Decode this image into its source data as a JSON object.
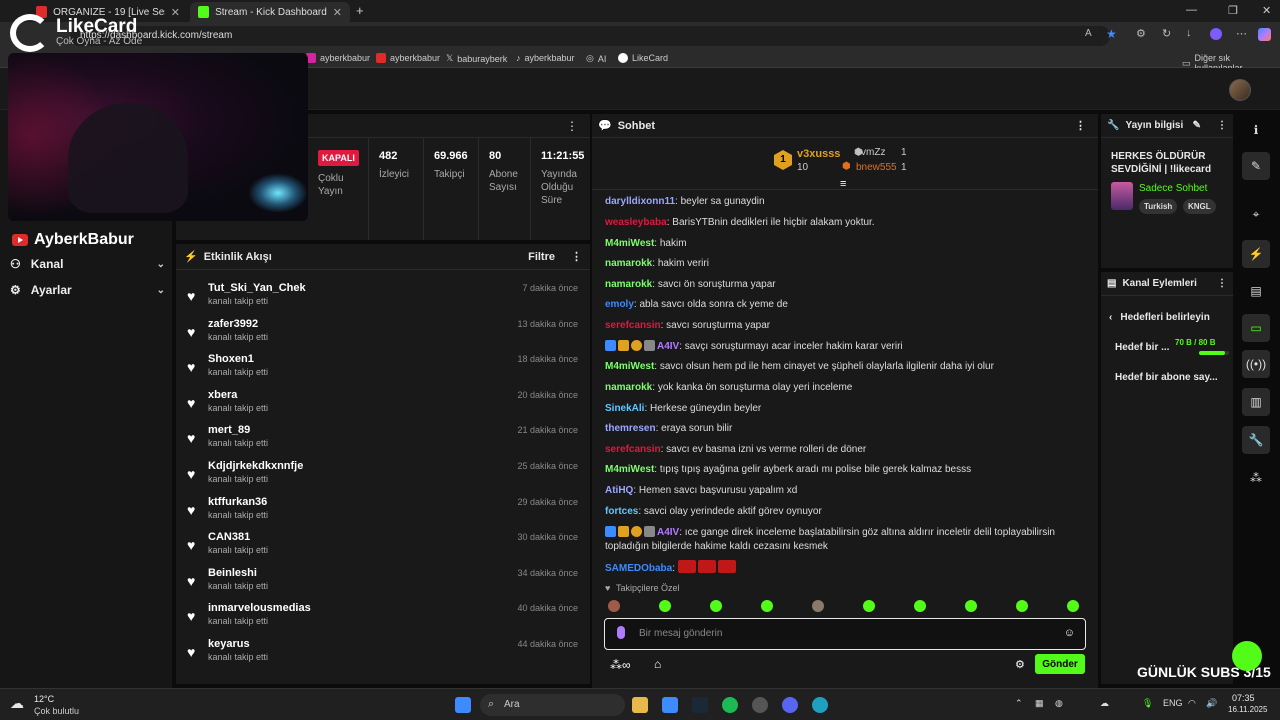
{
  "browser": {
    "tabs": [
      {
        "title": "ORGANIZE - 19 [Live Session] (p...",
        "icon": "youtube-icon"
      },
      {
        "title": "Stream - Kick Dashboard",
        "icon": "kick-icon"
      }
    ],
    "url": "https://dashboard.kick.com/stream",
    "bookmarks": [
      "ayberkbabur",
      "ayberkbabur",
      "baburayberk",
      "ayberkbabur",
      "AI",
      "LikeCard"
    ],
    "other_bookmarks": "Diğer sık kullanılanlar"
  },
  "overlay": {
    "logo_title": "LikeCard",
    "logo_sub": "Çok Oyna - Az Öde",
    "streamer": "AyberkBabur"
  },
  "sidebar": {
    "items": [
      {
        "label": "Kanal",
        "icon": "users-icon"
      },
      {
        "label": "Ayarlar",
        "icon": "gear-icon"
      }
    ]
  },
  "stats": {
    "status_badge": "KAPALI",
    "status_label": "Çoklu Yayın",
    "cols": [
      {
        "value": "482",
        "label": "İzleyici"
      },
      {
        "value": "69.966",
        "label": "Takipçi"
      },
      {
        "value": "80",
        "label": "Abone Sayısı"
      },
      {
        "value": "11:21:55",
        "label": "Yayında Olduğu Süre"
      }
    ]
  },
  "activity": {
    "title": "Etkinlik Akışı",
    "filter": "Filtre",
    "items": [
      {
        "user": "Tut_Ski_Yan_Chek",
        "action": "kanalı takip etti",
        "time": "7 dakika önce"
      },
      {
        "user": "zafer3992",
        "action": "kanalı takip etti",
        "time": "13 dakika önce"
      },
      {
        "user": "Shoxen1",
        "action": "kanalı takip etti",
        "time": "18 dakika önce"
      },
      {
        "user": "xbera",
        "action": "kanalı takip etti",
        "time": "20 dakika önce"
      },
      {
        "user": "mert_89",
        "action": "kanalı takip etti",
        "time": "21 dakika önce"
      },
      {
        "user": "Kdjdjrkekdkxnnfje",
        "action": "kanalı takip etti",
        "time": "25 dakika önce"
      },
      {
        "user": "ktffurkan36",
        "action": "kanalı takip etti",
        "time": "29 dakika önce"
      },
      {
        "user": "CAN381",
        "action": "kanalı takip etti",
        "time": "30 dakika önce"
      },
      {
        "user": "Beinleshi",
        "action": "kanalı takip etti",
        "time": "34 dakika önce"
      },
      {
        "user": "inmarvelousmedias",
        "action": "kanalı takip etti",
        "time": "40 dakika önce"
      },
      {
        "user": "keyarus",
        "action": "kanalı takip etti",
        "time": "44 dakika önce"
      }
    ]
  },
  "chat": {
    "title": "Sohbet",
    "pinned": {
      "top_user": "v3xusss",
      "top_count": "10",
      "top_rank": "1",
      "others": [
        {
          "user": "svmZz",
          "count": "1"
        },
        {
          "user": "bnew555",
          "count": "1"
        }
      ]
    },
    "messages": [
      {
        "user": "darylldixonn11",
        "color": "#9aa7ff",
        "text": "beyler sa gunaydin"
      },
      {
        "user": "weasleybaba",
        "color": "#e0193f",
        "text": "BarisYTBnin dedikleri ile hiçbir alakam yoktur."
      },
      {
        "user": "M4miWest",
        "color": "#7cff6b",
        "text": "hakim"
      },
      {
        "user": "namarokk",
        "color": "#7cff6b",
        "text": "hakim veriri"
      },
      {
        "user": "namarokk",
        "color": "#7cff6b",
        "text": "savcı ön soruşturma yapar"
      },
      {
        "user": "emoly",
        "color": "#3d8bff",
        "text": "abla savcı olda sonra ck yeme de"
      },
      {
        "user": "serefcansin",
        "color": "#e0193f",
        "text": "savcı soruşturma yapar"
      },
      {
        "user": "A4IV",
        "color": "#b07cff",
        "text": "savçı soruşturmayı acar inceler hakim karar veriri",
        "badges": true
      },
      {
        "user": "M4miWest",
        "color": "#7cff6b",
        "text": "savcı olsun hem pd ile hem cinayet ve şüpheli olaylarla ilgilenir daha iyi olur"
      },
      {
        "user": "namarokk",
        "color": "#7cff6b",
        "text": "yok kanka ön soruşturma olay yeri inceleme"
      },
      {
        "user": "SinekAli",
        "color": "#5fc8ff",
        "text": "Herkese güneydın beyler"
      },
      {
        "user": "themresen",
        "color": "#9aa7ff",
        "text": "eraya sorun bilir"
      },
      {
        "user": "serefcansin",
        "color": "#e0193f",
        "text": "savcı ev basma izni vs verme rolleri de döner"
      },
      {
        "user": "M4miWest",
        "color": "#7cff6b",
        "text": "tıpış tıpış ayağına gelir ayberk aradı mı polise bile gerek kalmaz besss"
      },
      {
        "user": "AtiHQ",
        "color": "#9aa7ff",
        "text": "Hemen savcı başvurusu yapalım xd"
      },
      {
        "user": "fortces",
        "color": "#5fc8ff",
        "text": "savci olay yerindede aktif görev oynuyor"
      },
      {
        "user": "A4IV",
        "color": "#b07cff",
        "text": "ıce gange direk inceleme başlatabilirsin göz altına aldırır inceletir delil toplayabilirsin topladığın bilgilerde hakime kaldı cezasını kesmek",
        "badges": true
      },
      {
        "user": "SAMEDObaba",
        "color": "#3d8bff",
        "text": ""
      }
    ],
    "followers_only": "Takipçilere Özel",
    "placeholder": "Bir mesaj gönderin",
    "send": "Gönder"
  },
  "stream_info": {
    "title": "Yayın bilgisi",
    "stream_title": "HERKES ÖLDÜRÜR SEVDİĞİNİ | !likecard",
    "category": "Sadece Sohbet",
    "tags": [
      "Turkish",
      "KNGL"
    ]
  },
  "channel_actions": {
    "title": "Kanal Eylemleri",
    "goals_title": "Hedefleri belirleyin",
    "goal1": "Hedef bir ...",
    "goal1_progress": "70 B / 80 B",
    "goal1_fraction": 0.875,
    "goal2": "Hedef bir abone say..."
  },
  "overlay_subs": "GÜNLÜK SUBS 3/15",
  "taskbar": {
    "weather_temp": "12°C",
    "weather_desc": "Çok bulutlu",
    "search": "Ara",
    "lang": "ENG",
    "time": "07:35",
    "date": "16.11.2025"
  },
  "colors": {
    "kick_green": "#53fc18",
    "offline_red": "#e0193f"
  }
}
